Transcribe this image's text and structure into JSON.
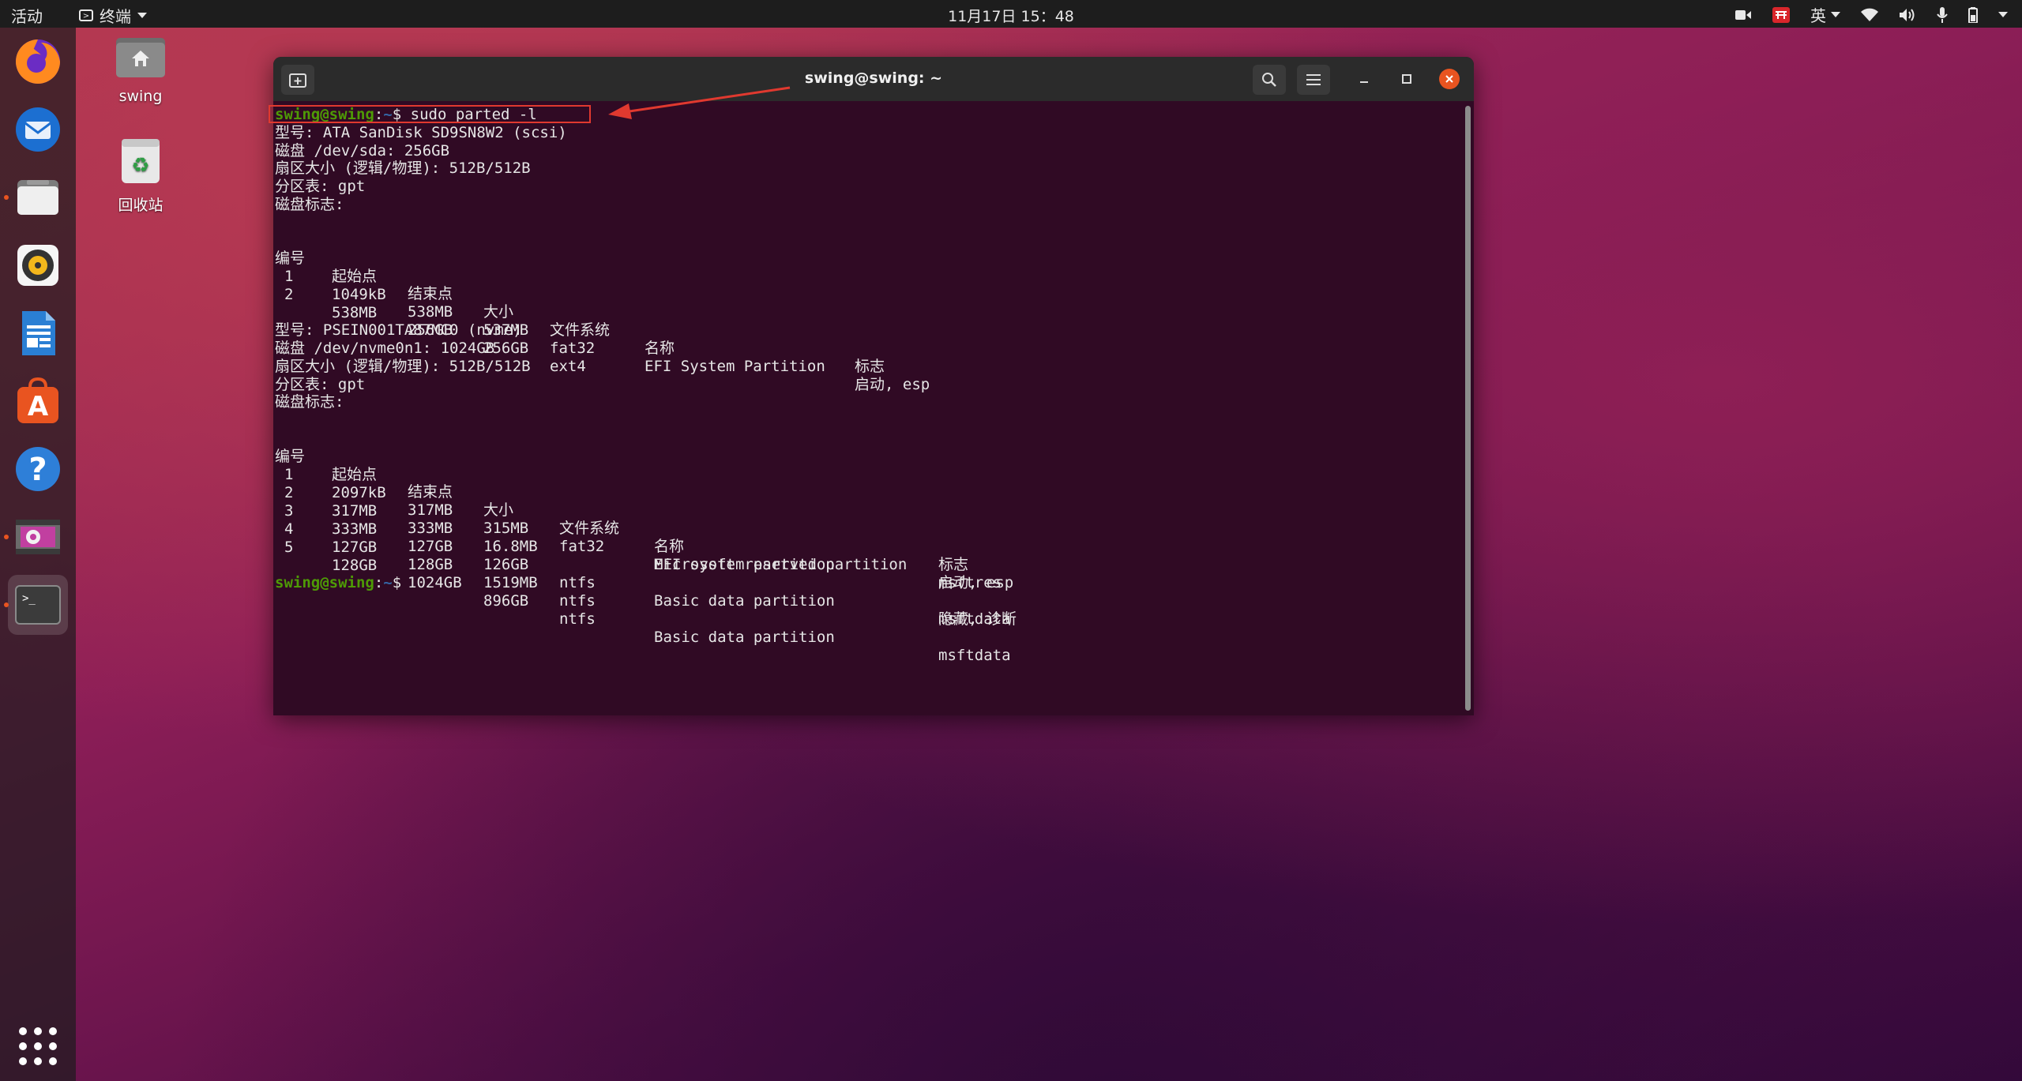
{
  "topbar": {
    "activities": "活动",
    "app_menu": "终端",
    "clock": "11月17日  15：48",
    "input_method": "英"
  },
  "desktop": {
    "home_label": "swing",
    "trash_label": "回收站"
  },
  "dock": {
    "items": [
      "firefox-icon",
      "thunderbird-icon",
      "files-icon",
      "rhythmbox-icon",
      "libreoffice-writer-icon",
      "ubuntu-software-icon",
      "help-icon",
      "video-app-icon",
      "terminal-icon"
    ]
  },
  "terminal": {
    "title": "swing@swing: ~",
    "prompt_user": "swing@swing",
    "prompt_sep": ":",
    "prompt_path": "~",
    "prompt_symbol": "$",
    "command": " sudo parted -l",
    "disk1": {
      "model": "型号: ATA SanDisk SD9SN8W2 (scsi)",
      "disk": "磁盘 /dev/sda: 256GB",
      "sector": "扇区大小 (逻辑/物理): 512B/512B",
      "table": "分区表: gpt",
      "flags": "磁盘标志:",
      "headers": [
        "编号",
        "起始点",
        "结束点",
        "大小",
        "文件系统",
        "名称",
        "标志"
      ],
      "rows": [
        [
          "1",
          "1049kB",
          "538MB",
          "537MB",
          "fat32",
          "EFI System Partition",
          "启动, esp"
        ],
        [
          "2",
          "538MB",
          "256GB",
          "256GB",
          "ext4",
          "",
          ""
        ]
      ]
    },
    "disk2": {
      "model": "型号: PSEIN001TA87MC0 (nvme)",
      "disk": "磁盘 /dev/nvme0n1: 1024GB",
      "sector": "扇区大小 (逻辑/物理): 512B/512B",
      "table": "分区表: gpt",
      "flags": "磁盘标志:",
      "headers": [
        "编号",
        "起始点",
        "结束点",
        "大小",
        "文件系统",
        "名称",
        "标志"
      ],
      "rows": [
        [
          "1",
          "2097kB",
          "317MB",
          "315MB",
          "fat32",
          "EFI system partition",
          "启动, esp"
        ],
        [
          "2",
          "317MB",
          "333MB",
          "16.8MB",
          "",
          "Microsoft reserved partition",
          "msftres"
        ],
        [
          "3",
          "333MB",
          "127GB",
          "126GB",
          "ntfs",
          "Basic data partition",
          "msftdata"
        ],
        [
          "4",
          "127GB",
          "128GB",
          "1519MB",
          "ntfs",
          "",
          "隐藏, 诊断"
        ],
        [
          "5",
          "128GB",
          "1024GB",
          "896GB",
          "ntfs",
          "Basic data partition",
          "msftdata"
        ]
      ]
    }
  },
  "colors": {
    "terminal_bg": "#300a24",
    "prompt_user": "#4e9a06",
    "prompt_path": "#3465a4",
    "highlight": "#e0392f",
    "ubuntu_orange": "#e95420"
  }
}
